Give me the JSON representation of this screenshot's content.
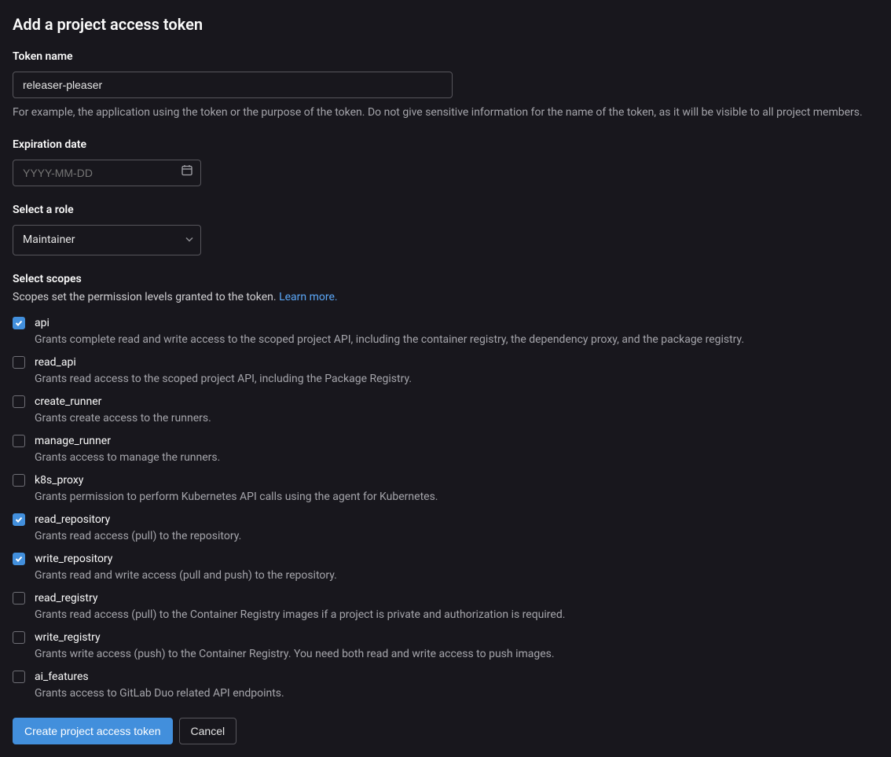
{
  "title": "Add a project access token",
  "token_name": {
    "label": "Token name",
    "value": "releaser-pleaser",
    "help": "For example, the application using the token or the purpose of the token. Do not give sensitive information for the name of the token, as it will be visible to all project members."
  },
  "expiration": {
    "label": "Expiration date",
    "placeholder": "YYYY-MM-DD",
    "value": ""
  },
  "role": {
    "label": "Select a role",
    "value": "Maintainer"
  },
  "scopes": {
    "label": "Select scopes",
    "description": "Scopes set the permission levels granted to the token. ",
    "learn_more": "Learn more.",
    "items": [
      {
        "name": "api",
        "desc": "Grants complete read and write access to the scoped project API, including the container registry, the dependency proxy, and the package registry.",
        "checked": true
      },
      {
        "name": "read_api",
        "desc": "Grants read access to the scoped project API, including the Package Registry.",
        "checked": false
      },
      {
        "name": "create_runner",
        "desc": "Grants create access to the runners.",
        "checked": false
      },
      {
        "name": "manage_runner",
        "desc": "Grants access to manage the runners.",
        "checked": false
      },
      {
        "name": "k8s_proxy",
        "desc": "Grants permission to perform Kubernetes API calls using the agent for Kubernetes.",
        "checked": false
      },
      {
        "name": "read_repository",
        "desc": "Grants read access (pull) to the repository.",
        "checked": true
      },
      {
        "name": "write_repository",
        "desc": "Grants read and write access (pull and push) to the repository.",
        "checked": true
      },
      {
        "name": "read_registry",
        "desc": "Grants read access (pull) to the Container Registry images if a project is private and authorization is required.",
        "checked": false
      },
      {
        "name": "write_registry",
        "desc": "Grants write access (push) to the Container Registry. You need both read and write access to push images.",
        "checked": false
      },
      {
        "name": "ai_features",
        "desc": "Grants access to GitLab Duo related API endpoints.",
        "checked": false
      }
    ]
  },
  "buttons": {
    "submit": "Create project access token",
    "cancel": "Cancel"
  }
}
